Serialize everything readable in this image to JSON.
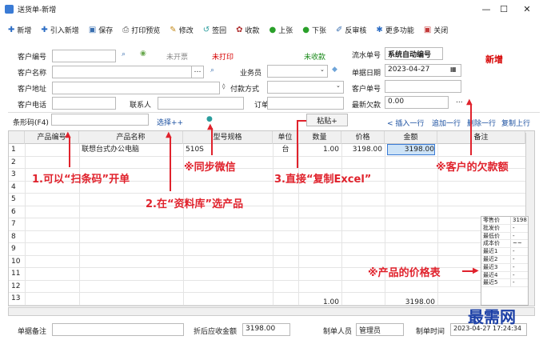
{
  "window": {
    "title": "送货单-新增",
    "min": "—",
    "max": "☐",
    "close": "✕"
  },
  "toolbar": [
    {
      "name": "new-button",
      "icon": "✚",
      "label": "新增"
    },
    {
      "name": "import-new-button",
      "icon": "✚",
      "label": "引入新增"
    },
    {
      "name": "save-button",
      "icon": "▣",
      "label": "保存"
    },
    {
      "name": "print-preview-button",
      "icon": "⎙",
      "label": "打印预览"
    },
    {
      "name": "modify-button",
      "icon": "✎",
      "label": "修改"
    },
    {
      "name": "return-button",
      "icon": "↺",
      "label": "签回"
    },
    {
      "name": "collect-button",
      "icon": "✿",
      "label": "收款"
    },
    {
      "name": "prev-button",
      "icon": "●",
      "label": "上张"
    },
    {
      "name": "next-button",
      "icon": "●",
      "label": "下张"
    },
    {
      "name": "unapprove-button",
      "icon": "✐",
      "label": "反审核"
    },
    {
      "name": "more-button",
      "icon": "✱",
      "label": "更多功能"
    },
    {
      "name": "close-button",
      "icon": "▣",
      "label": "关闭"
    }
  ],
  "form": {
    "customer_code_label": "客户编号",
    "customer_name_label": "客户名称",
    "customer_address_label": "客户地址",
    "customer_phone_label": "客户电话",
    "contact_label": "联系人",
    "salesperson_label": "业务员",
    "payment_label": "付款方式",
    "order_no_label": "订单号码",
    "serial_label": "流水单号",
    "serial_value": "系统自动编号",
    "date_label": "单据日期",
    "date_value": "2023-04-27",
    "cust_order_label": "客户单号",
    "debt_label": "最新欠款",
    "debt_value": "0.00",
    "status_invoice": "未开票",
    "status_print": "未打印",
    "status_collect": "未收款",
    "mode": "新增",
    "barcode_label": "条形码(F4)",
    "select_link": "选择++",
    "paste_button": "粘贴+",
    "insert_row": "< 插入一行",
    "add_row": "追加一行",
    "delete_row": "删除一行",
    "copy_row": "复制上行"
  },
  "grid": {
    "columns": [
      "产品编号",
      "产品名称",
      "型号规格",
      "单位",
      "数量",
      "价格",
      "金额",
      "备注"
    ],
    "rows": [
      {
        "n": "1",
        "code": "",
        "name": "联想台式办公电脑",
        "spec": "510S",
        "unit": "台",
        "qty": "1.00",
        "price": "3198.00",
        "amount": "3198.00",
        "remark": ""
      },
      {
        "n": "2"
      },
      {
        "n": "3"
      },
      {
        "n": "4"
      },
      {
        "n": "5"
      },
      {
        "n": "6"
      },
      {
        "n": "7"
      },
      {
        "n": "8"
      },
      {
        "n": "9"
      },
      {
        "n": "10"
      },
      {
        "n": "11"
      },
      {
        "n": "12"
      },
      {
        "n": "13"
      }
    ],
    "total_qty": "1.00",
    "total_amount": "3198.00"
  },
  "price_table": [
    {
      "k": "零售价",
      "v": "3198"
    },
    {
      "k": "批发价",
      "v": "-"
    },
    {
      "k": "最低价",
      "v": "-"
    },
    {
      "k": "成本价",
      "v": "~~"
    },
    {
      "k": "最近1",
      "v": "-"
    },
    {
      "k": "最近2",
      "v": "-"
    },
    {
      "k": "最近3",
      "v": "-"
    },
    {
      "k": "最近4",
      "v": "-"
    },
    {
      "k": "最近5",
      "v": "-"
    }
  ],
  "footer": {
    "remark_label": "单据备注",
    "discount_label": "折后应收金额",
    "discount_value": "3198.00",
    "maker_label": "制单人员",
    "maker_value": "管理员",
    "time_label": "制单时间",
    "time_value": "2023-04-27 17:24:34"
  },
  "annotations": {
    "a1": "1.可以“扫条码”开单",
    "a2": "※同步微信",
    "a3": "3.直接“复制Excel”",
    "a4": "※客户的欠款额",
    "a5": "2.在“资料库”选产品",
    "a6": "※产品的价格表",
    "watermark": "最需网"
  }
}
